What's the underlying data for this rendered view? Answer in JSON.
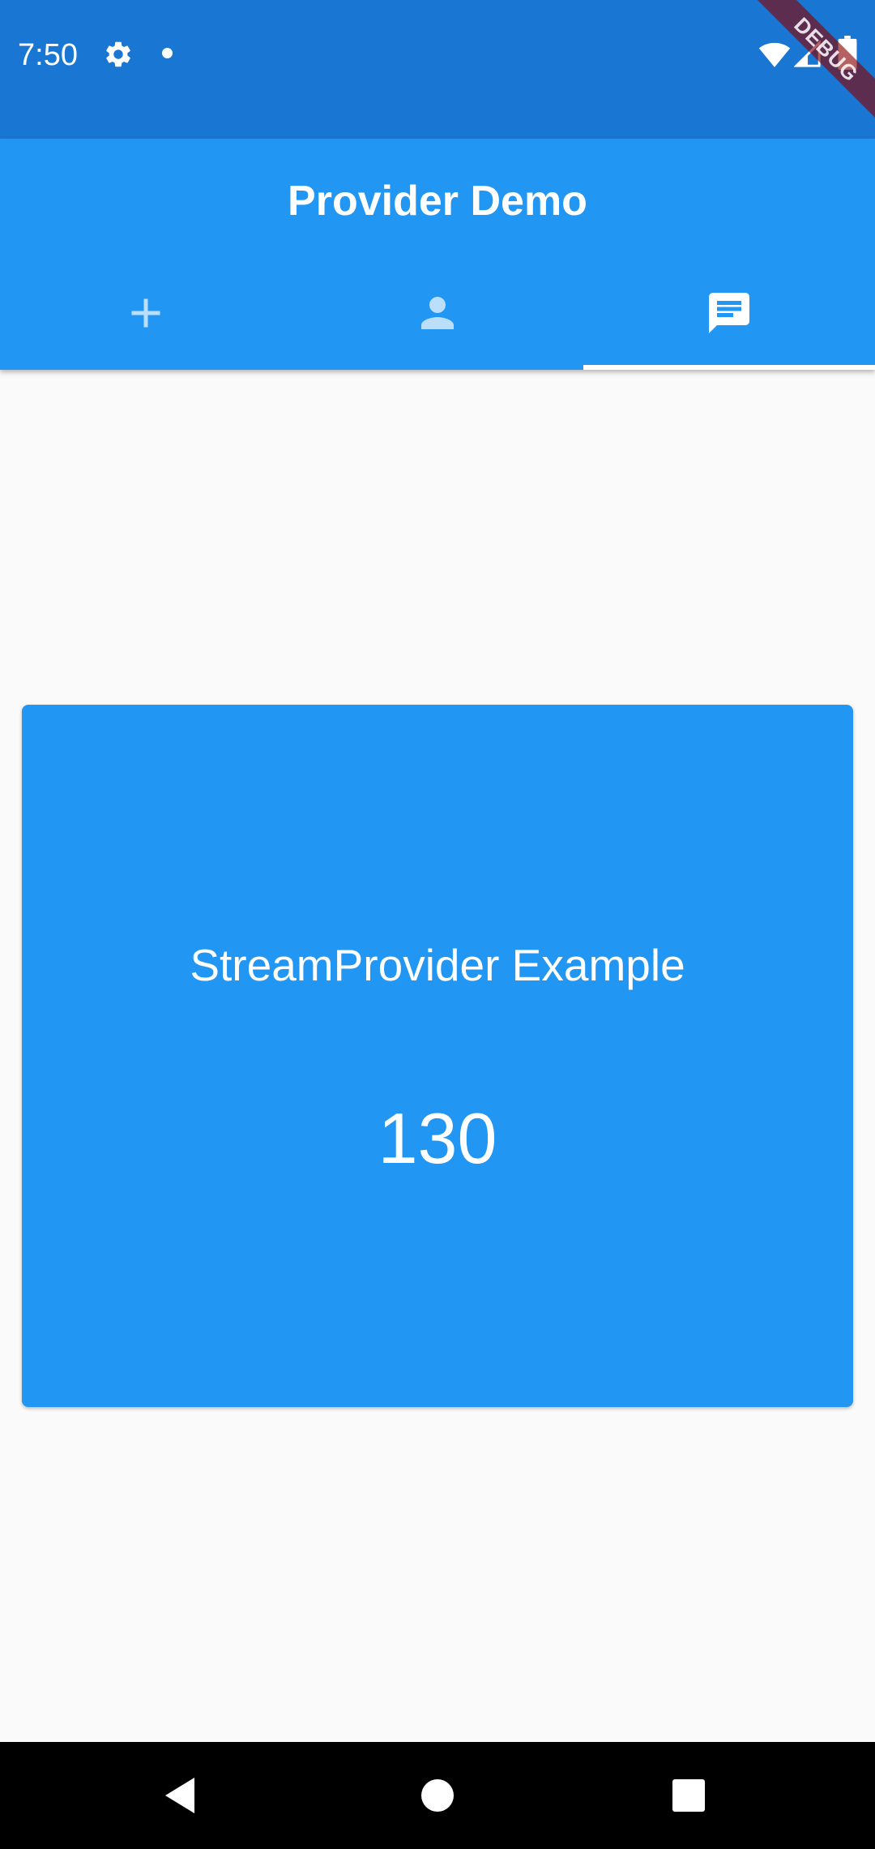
{
  "status_bar": {
    "time": "7:50",
    "icons": [
      "gear-icon",
      "notification-dot-icon",
      "wifi-icon",
      "signal-icon",
      "battery-icon"
    ]
  },
  "debug_banner": {
    "label": "DEBUG"
  },
  "app_bar": {
    "title": "Provider Demo",
    "tabs": [
      {
        "icon": "add-icon",
        "selected": false
      },
      {
        "icon": "person-icon",
        "selected": false
      },
      {
        "icon": "message-icon",
        "selected": true
      }
    ]
  },
  "card": {
    "title": "StreamProvider Example",
    "value": "130"
  },
  "nav_bar": {
    "icons": [
      "back-icon",
      "home-icon",
      "recents-icon"
    ]
  },
  "colors": {
    "status_bar": "#1976D2",
    "primary": "#2196F3",
    "background": "#FAFAFA",
    "tab_inactive": "#BBDEFB",
    "tab_active": "#FFFFFF"
  }
}
